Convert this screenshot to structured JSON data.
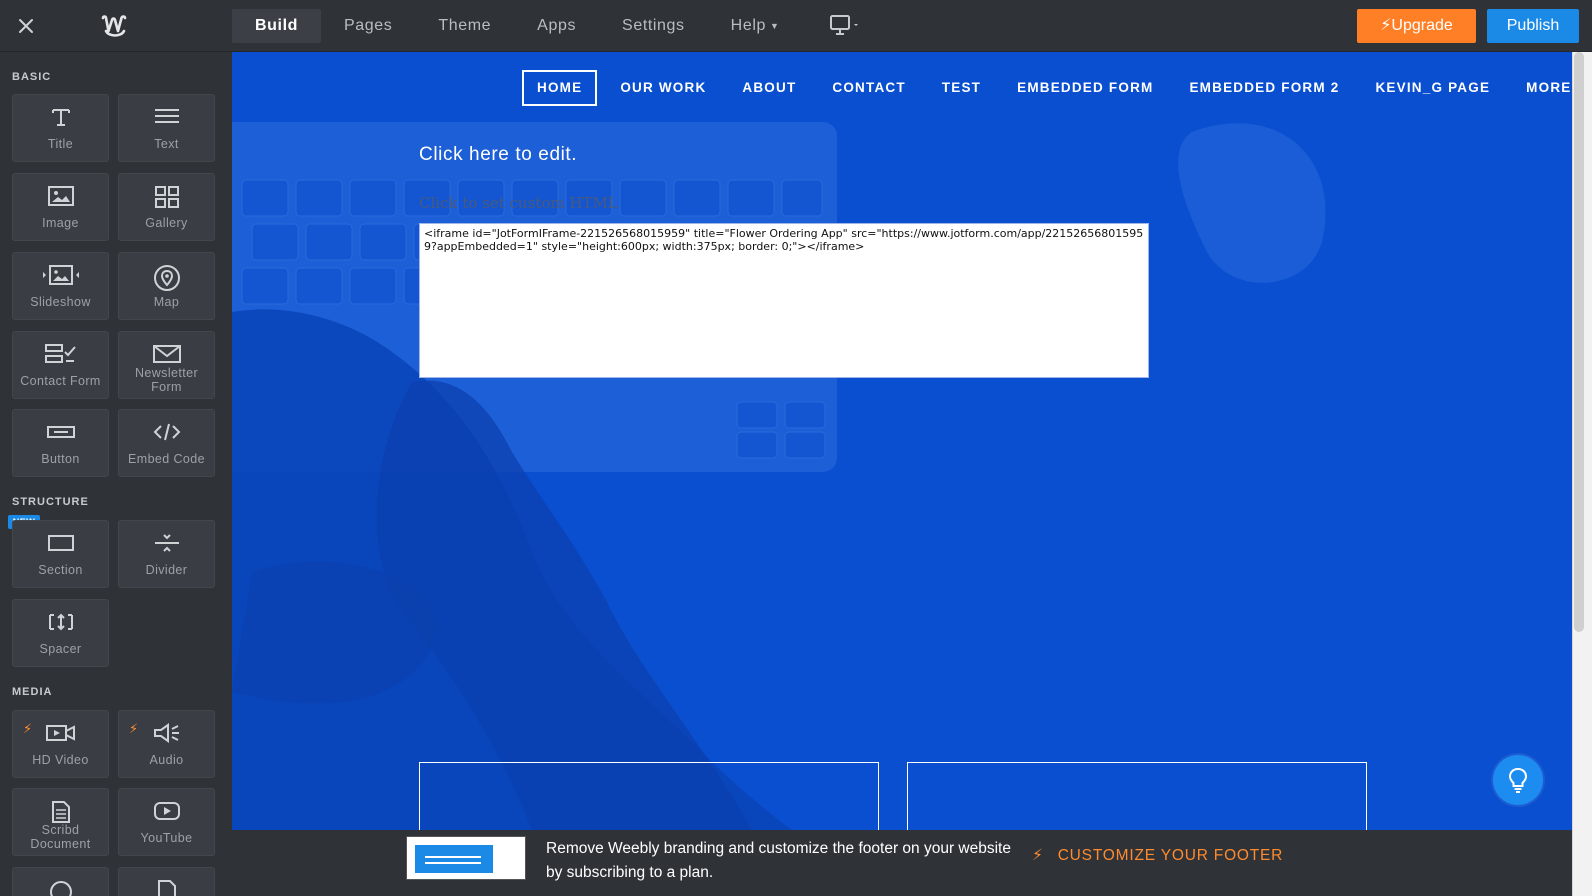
{
  "topbar": {
    "nav": [
      "Build",
      "Pages",
      "Theme",
      "Apps",
      "Settings",
      "Help"
    ],
    "upgrade_label": "Upgrade",
    "publish_label": "Publish"
  },
  "sidebar": {
    "basic_label": "BASIC",
    "structure_label": "STRUCTURE",
    "media_label": "MEDIA",
    "new_badge": "NEW",
    "tiles": {
      "title": "Title",
      "text": "Text",
      "image": "Image",
      "gallery": "Gallery",
      "slideshow": "Slideshow",
      "map": "Map",
      "contact_form": "Contact Form",
      "newsletter_form_1": "Newsletter",
      "newsletter_form_2": "Form",
      "button": "Button",
      "embed_code": "Embed Code",
      "section": "Section",
      "divider": "Divider",
      "spacer": "Spacer",
      "hd_video": "HD Video",
      "audio": "Audio",
      "scribd_1": "Scribd",
      "scribd_2": "Document",
      "youtube": "YouTube"
    }
  },
  "site": {
    "nav": [
      "HOME",
      "OUR WORK",
      "ABOUT",
      "CONTACT",
      "TEST",
      "EMBEDDED FORM",
      "EMBEDDED FORM 2",
      "KEVIN_G PAGE",
      "MORE..."
    ],
    "edit_text": "Click here to edit.",
    "custom_html_label": "Click to set custom HTML",
    "embed_code": "<iframe id=\"JotFormIFrame-221526568015959\" title=\"Flower Ordering App\" src=\"https://www.jotform.com/app/221526568015959?appEmbedded=1\" style=\"height:600px; width:375px; border: 0;\"></iframe>"
  },
  "footer": {
    "message": "Remove Weebly branding and customize the footer on your website by subscribing to a plan.",
    "cta": "CUSTOMIZE YOUR FOOTER"
  },
  "colors": {
    "accent_orange": "#ff7f26",
    "accent_blue": "#1a8ae6",
    "canvas_blue": "#0a4fd0",
    "chrome": "#2f3338"
  }
}
